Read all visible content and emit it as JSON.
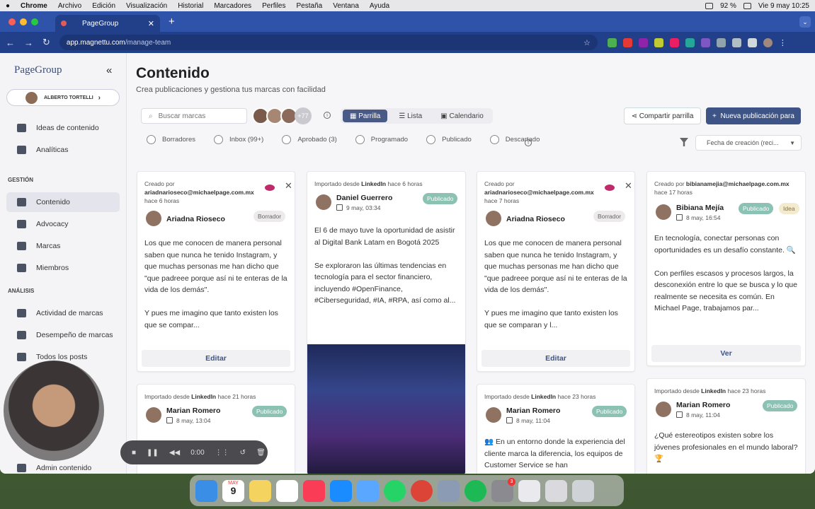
{
  "macos": {
    "apple": "",
    "app": "Chrome",
    "menus": [
      "Archivo",
      "Edición",
      "Visualización",
      "Historial",
      "Marcadores",
      "Perfiles",
      "Pestaña",
      "Ventana",
      "Ayuda"
    ],
    "battery": "92 %",
    "datetime": "Vie 9 may 10:25"
  },
  "browser": {
    "tab_title": "PageGroup",
    "url_domain": "app.magnettu.com",
    "url_path": "/manage-team"
  },
  "sidebar": {
    "logo": "PageGroup",
    "user": "ALBERTO TORTELLI",
    "items_top": [
      {
        "label": "Ideas de contenido",
        "icon": "lightbulb-icon"
      },
      {
        "label": "Analíticas",
        "icon": "chart-icon"
      }
    ],
    "section_gestion": "GESTIÓN",
    "items_gestion": [
      {
        "label": "Contenido",
        "icon": "content-icon"
      },
      {
        "label": "Advocacy",
        "icon": "megaphone-icon"
      },
      {
        "label": "Marcas",
        "icon": "brands-icon"
      },
      {
        "label": "Miembros",
        "icon": "members-icon"
      }
    ],
    "section_analisis": "ANÁLISIS",
    "items_analisis": [
      {
        "label": "Actividad de marcas",
        "icon": "activity-icon"
      },
      {
        "label": "Desempeño de marcas",
        "icon": "performance-icon"
      },
      {
        "label": "Todos los posts",
        "icon": "star-icon"
      },
      {
        "label": "Admin contenido",
        "icon": "admin-icon"
      }
    ]
  },
  "main": {
    "title": "Contenido",
    "subtitle": "Crea publicaciones y gestiona tus marcas con facilidad",
    "search_placeholder": "Buscar marcas",
    "avatar_more": "+77",
    "views": [
      "Parrilla",
      "Lista",
      "Calendario"
    ],
    "share_label": "Compartir parrilla",
    "new_label": "Nueva publicación para",
    "filters": [
      "Borradores",
      "Inbox (99+)",
      "Aprobado (3)",
      "Programado",
      "Publicado",
      "Descartado"
    ],
    "sort_label": "Fecha de creación (reci..."
  },
  "cards": [
    {
      "meta1": "Creado por",
      "meta2": "ariadnarioseco@michaelpage.com.mx",
      "meta3": "hace 6 horas",
      "name": "Ariadna Rioseco",
      "badge": "Borrador",
      "body": "Los que me conocen de manera personal saben que nunca he tenido Instagram, y que muchas personas me han dicho que \"que padreee porque así ni te enteras de la vida de los demás\".\n\nY pues me imagino que tanto existen los que se compar...",
      "action": "Editar"
    },
    {
      "meta_prefix": "Importado desde",
      "meta_source": "LinkedIn",
      "meta_time": "hace 6 horas",
      "name": "Daniel Guerrero",
      "date": "9 may, 03:34",
      "badge": "Publicado",
      "body": "El 6 de mayo tuve la oportunidad de asistir al Digital Bank Latam en Bogotá 2025\n\nSe exploraron las últimas tendencias en tecnología para el sector financiero, incluyendo #OpenFinance, #Ciberseguridad, #IA, #RPA, así como al..."
    },
    {
      "meta1": "Creado por",
      "meta2": "ariadnarioseco@michaelpage.com.mx",
      "meta3": "hace 7 horas",
      "name": "Ariadna Rioseco",
      "badge": "Borrador",
      "body": "Los que me conocen de manera personal saben que nunca he tenido Instagram, y que muchas personas me han dicho que \"que padreee porque así ni te enteras de la vida de los demás\".\n\nY pues me imagino que tanto existen los que se comparan y l...",
      "action": "Editar"
    },
    {
      "meta_prefix": "Creado por",
      "meta_source": "bibianamejia@michaelpage.com.mx",
      "meta_time": "hace 17 horas",
      "name": "Bibiana Mejía",
      "date": "8 may, 16:54",
      "badge": "Publicado",
      "badge2": "Idea",
      "body": "En tecnología, conectar personas con oportunidades es un desafío constante. 🔍\n\nCon perfiles escasos y procesos largos, la desconexión entre lo que se busca y lo que realmente se necesita es común. En Michael Page, trabajamos par...",
      "action": "Ver"
    },
    {
      "meta_prefix": "Importado desde",
      "meta_source": "LinkedIn",
      "meta_time": "hace 21 horas",
      "name": "Marian Romero",
      "date": "8 may, 13:04",
      "badge": "Publicado"
    },
    {
      "meta_prefix": "Importado desde",
      "meta_source": "LinkedIn",
      "meta_time": "hace 23 horas",
      "name": "Marian Romero",
      "date": "8 may, 11:04",
      "badge": "Publicado",
      "body": "👥 En un entorno donde la experiencia del cliente marca la diferencia, los equipos de Customer Service se han"
    },
    {
      "meta_prefix": "Importado desde",
      "meta_source": "LinkedIn",
      "meta_time": "hace 23 horas",
      "name": "Marian Romero",
      "date": "8 may, 11:04",
      "badge": "Publicado",
      "body": "¿Qué estereotipos existen sobre los jóvenes profesionales en el mundo laboral? 🏆"
    }
  ],
  "recorder": {
    "time": "0:00"
  },
  "dock": {
    "calendar_month": "MAY",
    "calendar_day": "9",
    "badge": "3"
  },
  "colors": {
    "accent": "#3f5486",
    "published": "#8cc2b3",
    "eye": "#c0296a",
    "chrome": "#2f53a8"
  }
}
